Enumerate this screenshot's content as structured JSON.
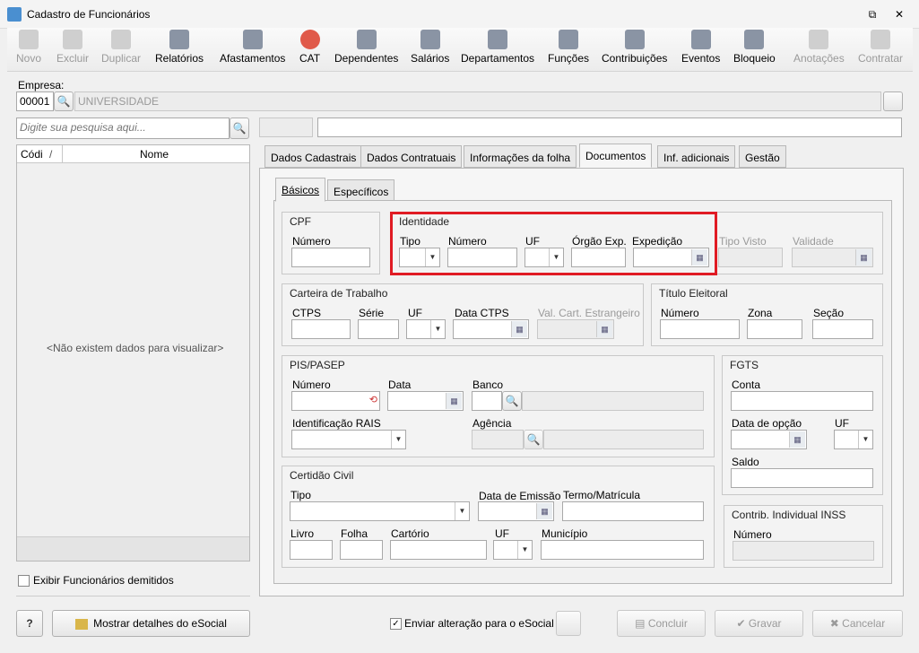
{
  "window": {
    "title": "Cadastro de Funcionários",
    "restore_icon": "restore-icon",
    "close_icon": "close-icon",
    "close_label": "✕",
    "restore_label": "⧉"
  },
  "toolbar": [
    "Novo",
    "Excluir",
    "Duplicar",
    "Relatórios",
    "Afastamentos",
    "CAT",
    "Dependentes",
    "Salários",
    "Departamentos",
    "Funções",
    "Contribuições",
    "Eventos",
    "Bloqueio",
    "Anotações",
    "Contratar"
  ],
  "empresa": {
    "label": "Empresa:",
    "code": "00001",
    "name": "UNIVERSIDADE"
  },
  "search": {
    "placeholder": "Digite sua pesquisa aqui..."
  },
  "grid": {
    "col_code": "Códi",
    "col_sort": "/",
    "col_name": "Nome",
    "empty": "<Não existem dados para visualizar>"
  },
  "show_dismissed": "Exibir Funcionários demitidos",
  "tabs": [
    "Dados Cadastrais",
    "Dados Contratuais",
    "Informações da folha",
    "Documentos",
    "Inf. adicionais",
    "Gestão"
  ],
  "subtabs": [
    "Básicos",
    "Específicos"
  ],
  "cpf": {
    "title": "CPF",
    "numero": "Número"
  },
  "identidade": {
    "title": "Identidade",
    "tipo": "Tipo",
    "numero": "Número",
    "uf": "UF",
    "orgao": "Órgão Exp.",
    "expedicao": "Expedição"
  },
  "visto": {
    "tipo": "Tipo Visto",
    "validade": "Validade"
  },
  "ctps": {
    "title": "Carteira de Trabalho",
    "ctps": "CTPS",
    "serie": "Série",
    "uf": "UF",
    "data": "Data CTPS",
    "val": "Val. Cart. Estrangeiro"
  },
  "titulo": {
    "title": "Título Eleitoral",
    "numero": "Número",
    "zona": "Zona",
    "secao": "Seção"
  },
  "pis": {
    "title": "PIS/PASEP",
    "numero": "Número",
    "data": "Data",
    "banco": "Banco",
    "rais": "Identificação RAIS",
    "agencia": "Agência"
  },
  "fgts": {
    "title": "FGTS",
    "conta": "Conta",
    "data": "Data de opção",
    "uf": "UF",
    "saldo": "Saldo"
  },
  "certidao": {
    "title": "Certidão Civil",
    "tipo": "Tipo",
    "emissao": "Data de Emissão",
    "termo": "Termo/Matrícula",
    "livro": "Livro",
    "folha": "Folha",
    "cartorio": "Cartório",
    "uf": "UF",
    "municipio": "Município"
  },
  "inss": {
    "title": "Contrib. Individual INSS",
    "numero": "Número"
  },
  "footer": {
    "help": "?",
    "esocial_details": "Mostrar detalhes do eSocial",
    "send_esocial": "Enviar alteração para o eSocial",
    "concluir": "Concluir",
    "gravar": "Gravar",
    "cancelar": "Cancelar"
  },
  "icons": {
    "dropdown": "▼",
    "calendar": "▦",
    "search": "🔍",
    "check": "✓"
  }
}
